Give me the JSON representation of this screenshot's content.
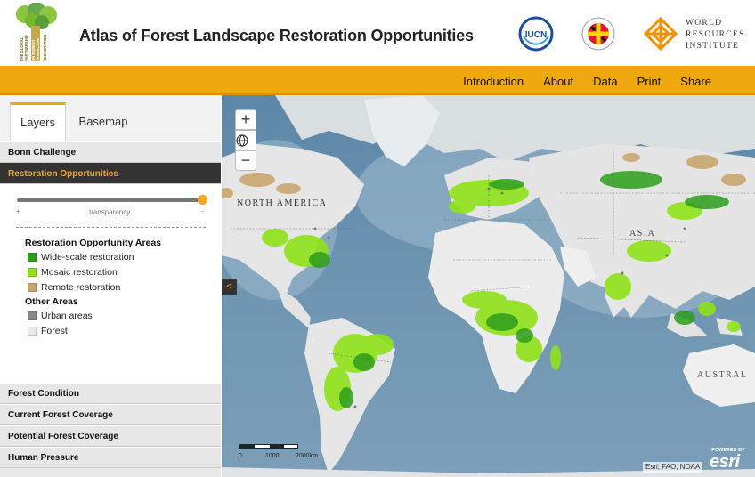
{
  "header": {
    "title": "Atlas of Forest Landscape Restoration Opportunities",
    "logo_gplr_text": "THE GLOBAL PARTNERSHIP ON FOREST LANDSCAPE RESTORATION",
    "logo_iucn_text": "IUCN",
    "logo_wri_line1": "WORLD",
    "logo_wri_line2": "RESOURCES",
    "logo_wri_line3": "INSTITUTE"
  },
  "nav": {
    "items": [
      "Introduction",
      "About",
      "Data",
      "Print",
      "Share"
    ]
  },
  "panel": {
    "tabs": [
      "Layers",
      "Basemap"
    ],
    "sections": {
      "bonn": "Bonn Challenge",
      "restoration": "Restoration Opportunities",
      "forest_condition": "Forest Condition",
      "current_coverage": "Current Forest Coverage",
      "potential_coverage": "Potential Forest Coverage",
      "human_pressure": "Human Pressure"
    },
    "slider": {
      "plus": "+",
      "label": "transparency",
      "minus": "-",
      "value_fraction": 0.99
    },
    "legend": {
      "heading_restoration": "Restoration Opportunity Areas",
      "wide": "Wide-scale restoration",
      "mosaic": "Mosaic restoration",
      "remote": "Remote restoration",
      "heading_other": "Other Areas",
      "urban": "Urban areas",
      "forest": "Forest"
    },
    "colors": {
      "wide": "#2e9e1c",
      "mosaic": "#8fe21a",
      "remote": "#c9a36a",
      "urban": "#888888",
      "forest": "#e8e8e8",
      "accent": "#efa80e"
    }
  },
  "map": {
    "zoom_in": "+",
    "zoom_out": "−",
    "collapse": "<",
    "labels": {
      "asia": "ASIA",
      "namerica": "NORTH AMERICA",
      "australia": "AUSTRAL"
    },
    "scale": {
      "zero": "0",
      "mid": "1000",
      "max": "2000km"
    },
    "attribution": "Esri, FAO, NOAA",
    "esri_powered": "POWERED BY",
    "esri_word": "esri"
  },
  "icons": {
    "home": "globe-icon",
    "collapse": "chevron-left-icon"
  }
}
